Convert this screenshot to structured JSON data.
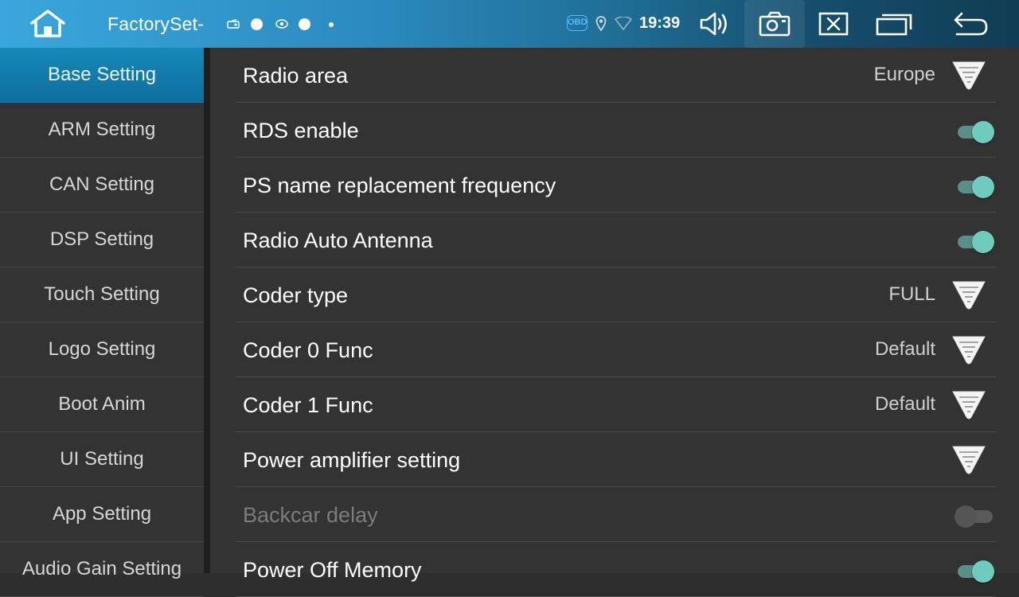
{
  "topbar": {
    "title": "FactorySet-",
    "time": "19:39",
    "obd_label": "OBD",
    "icons": [
      "home-icon",
      "radio-icon",
      "dot-icon",
      "camera-signal-icon",
      "dot-icon",
      "small-dot-icon",
      "obd-icon",
      "location-icon",
      "wifi-icon",
      "volume-icon",
      "screenshot-icon",
      "close-icon",
      "recent-apps-icon",
      "back-icon"
    ]
  },
  "sidebar": {
    "items": [
      {
        "label": "Base Setting",
        "selected": true
      },
      {
        "label": "ARM Setting"
      },
      {
        "label": "CAN Setting"
      },
      {
        "label": "DSP Setting"
      },
      {
        "label": "Touch Setting"
      },
      {
        "label": "Logo Setting"
      },
      {
        "label": "Boot Anim"
      },
      {
        "label": "UI Setting"
      },
      {
        "label": "App Setting"
      },
      {
        "label": "Audio Gain Setting"
      }
    ]
  },
  "settings": {
    "rows": [
      {
        "label": "Radio area",
        "control": "dropdown",
        "value": "Europe"
      },
      {
        "label": "RDS enable",
        "control": "toggle",
        "on": true
      },
      {
        "label": "PS name replacement frequency",
        "control": "toggle",
        "on": true
      },
      {
        "label": "Radio Auto Antenna",
        "control": "toggle",
        "on": true
      },
      {
        "label": "Coder type",
        "control": "dropdown",
        "value": "FULL"
      },
      {
        "label": "Coder 0 Func",
        "control": "dropdown",
        "value": "Default"
      },
      {
        "label": "Coder 1 Func",
        "control": "dropdown",
        "value": "Default"
      },
      {
        "label": "Power amplifier setting",
        "control": "dropdown",
        "value": ""
      },
      {
        "label": "Backcar delay",
        "control": "toggle",
        "on": false,
        "disabled": true
      },
      {
        "label": "Power Off Memory",
        "control": "toggle",
        "on": true
      }
    ]
  },
  "colors": {
    "accent": "#1688b8",
    "toggle_on": "#6fcbbd",
    "background": "#333333"
  }
}
